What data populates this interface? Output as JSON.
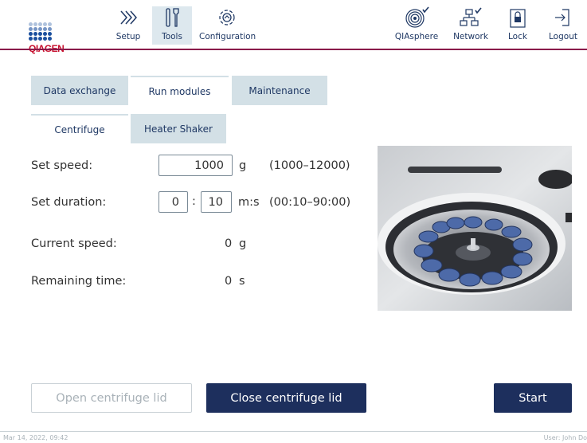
{
  "brand": {
    "logo_text": "QIAGEN",
    "accent": "#8a1a4a",
    "navy": "#1d2f5d",
    "tab_bg": "#d3e0e6"
  },
  "nav": {
    "setup": "Setup",
    "tools": "Tools",
    "configuration": "Configuration",
    "qiasphere": "QIAsphere",
    "network": "Network",
    "lock": "Lock",
    "logout": "Logout"
  },
  "tabs": [
    {
      "label": "Data exchange",
      "active": false
    },
    {
      "label": "Run modules",
      "active": true
    },
    {
      "label": "Maintenance",
      "active": false
    }
  ],
  "subtabs": [
    {
      "label": "Centrifuge",
      "active": true
    },
    {
      "label": "Heater Shaker",
      "active": false
    }
  ],
  "form": {
    "set_speed_label": "Set speed:",
    "set_speed_value": "1000",
    "set_speed_unit": "g",
    "set_speed_range": "(1000–12000)",
    "set_duration_label": "Set duration:",
    "duration_minutes": "0",
    "duration_separator": ":",
    "duration_seconds": "10",
    "duration_unit": "m:s",
    "duration_range": "(00:10–90:00)",
    "current_speed_label": "Current speed:",
    "current_speed_value": "0",
    "current_speed_unit": "g",
    "remaining_time_label": "Remaining time:",
    "remaining_time_value": "0",
    "remaining_time_unit": "s"
  },
  "buttons": {
    "open_lid": "Open centrifuge lid",
    "close_lid": "Close centrifuge lid",
    "start": "Start"
  },
  "footer": {
    "timestamp": "Mar 14, 2022, 09:42",
    "user": "User: John Do"
  }
}
